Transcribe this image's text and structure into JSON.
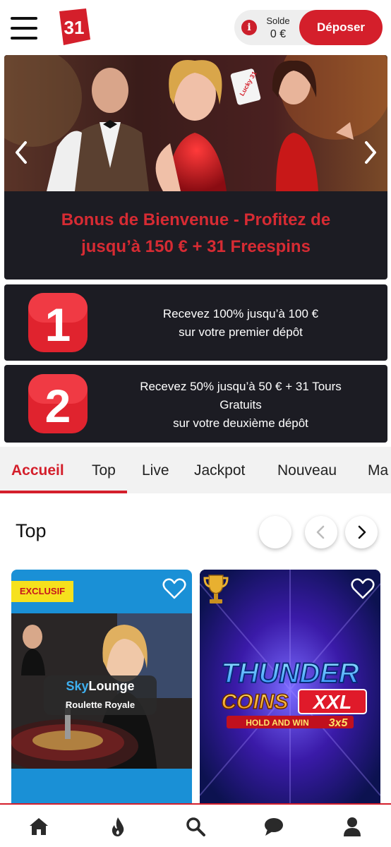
{
  "header": {
    "logo_text": "31",
    "balance_label": "Solde",
    "balance_value": "0 €",
    "deposit_label": "Déposer",
    "info_glyph": "i"
  },
  "hero": {
    "title_line1": "Bonus de Bienvenue - Profitez de",
    "title_line2": "jusqu’à 150 € + 31 Freespins",
    "card_text": "Lucky 31"
  },
  "steps": [
    {
      "number": "1",
      "line1": "Recevez 100% jusqu’à 100 €",
      "line2": "sur votre premier dépôt",
      "line3": ""
    },
    {
      "number": "2",
      "line1": "Recevez 50% jusqu’à 50 € + 31 Tours",
      "line2": "Gratuits",
      "line3": "sur votre deuxième dépôt"
    }
  ],
  "tabs": [
    {
      "label": "Accueil",
      "active": true
    },
    {
      "label": "Top",
      "active": false
    },
    {
      "label": "Live",
      "active": false
    },
    {
      "label": "Jackpot",
      "active": false
    },
    {
      "label": "Nouveau",
      "active": false
    },
    {
      "label": "Ma",
      "active": false
    }
  ],
  "section": {
    "title": "Top"
  },
  "games": [
    {
      "badge": "EXCLUSIF",
      "brand_sky": "Sky",
      "brand_lounge": "Lounge",
      "subtitle": "Roulette Royale"
    },
    {
      "line1": "THUNDER",
      "line2": "COINS",
      "line3": "XXL",
      "line4": "HOLD AND WIN",
      "line5": "3x5"
    }
  ],
  "nav_icons": [
    "home-icon",
    "flame-icon",
    "search-icon",
    "chat-icon",
    "user-icon"
  ],
  "colors": {
    "accent": "#d41f2b",
    "dark": "#1c1c23",
    "badge_yellow": "#f6e11d"
  }
}
